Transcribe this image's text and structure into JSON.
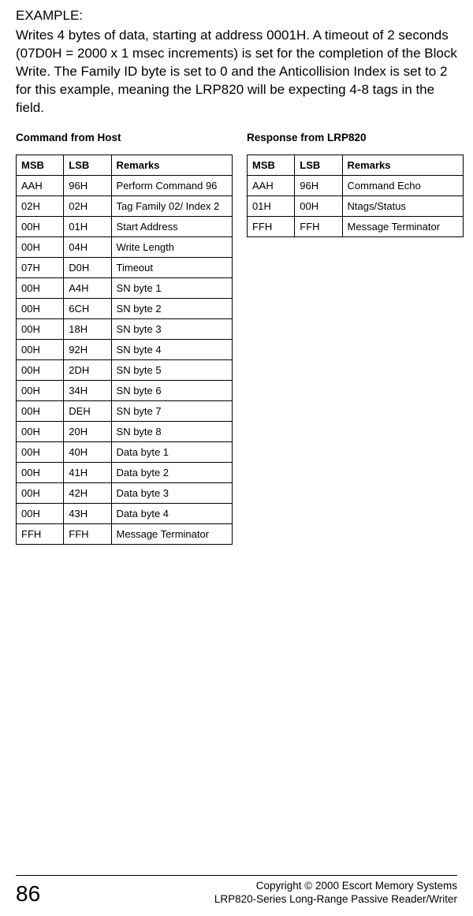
{
  "example_label": "EXAMPLE:",
  "intro": "Writes 4 bytes of data, starting at address 0001H. A timeout of 2 seconds (07D0H = 2000 x 1 msec increments) is set for the completion of the Block Write.  The Family ID byte is set to 0 and the Anticollision Index is set to 2 for this example, meaning the LRP820 will be expecting 4-8 tags in the field.",
  "left_title": "Command from Host",
  "right_title": "Response from LRP820",
  "headers": {
    "msb": "MSB",
    "lsb": "LSB",
    "remarks": "Remarks"
  },
  "left_rows": [
    {
      "msb": "AAH",
      "lsb": "96H",
      "remarks": "Perform Command 96"
    },
    {
      "msb": "02H",
      "lsb": "02H",
      "remarks": "Tag Family 02/ Index 2"
    },
    {
      "msb": "00H",
      "lsb": "01H",
      "remarks": "Start Address"
    },
    {
      "msb": "00H",
      "lsb": "04H",
      "remarks": "Write Length"
    },
    {
      "msb": "07H",
      "lsb": "D0H",
      "remarks": "Timeout"
    },
    {
      "msb": "00H",
      "lsb": "A4H",
      "remarks": "SN byte 1"
    },
    {
      "msb": "00H",
      "lsb": "6CH",
      "remarks": "SN byte 2"
    },
    {
      "msb": "00H",
      "lsb": "18H",
      "remarks": "SN byte 3"
    },
    {
      "msb": "00H",
      "lsb": "92H",
      "remarks": "SN byte 4"
    },
    {
      "msb": "00H",
      "lsb": "2DH",
      "remarks": "SN byte 5"
    },
    {
      "msb": "00H",
      "lsb": "34H",
      "remarks": "SN byte 6"
    },
    {
      "msb": "00H",
      "lsb": "DEH",
      "remarks": "SN byte 7"
    },
    {
      "msb": "00H",
      "lsb": "20H",
      "remarks": "SN byte 8"
    },
    {
      "msb": "00H",
      "lsb": "40H",
      "remarks": "Data byte 1"
    },
    {
      "msb": "00H",
      "lsb": "41H",
      "remarks": "Data byte 2"
    },
    {
      "msb": "00H",
      "lsb": "42H",
      "remarks": "Data byte 3"
    },
    {
      "msb": "00H",
      "lsb": "43H",
      "remarks": "Data byte 4"
    },
    {
      "msb": "FFH",
      "lsb": "FFH",
      "remarks": "Message Terminator"
    }
  ],
  "right_rows": [
    {
      "msb": "AAH",
      "lsb": "96H",
      "remarks": "Command Echo"
    },
    {
      "msb": "01H",
      "lsb": "00H",
      "remarks": "Ntags/Status"
    },
    {
      "msb": "FFH",
      "lsb": "FFH",
      "remarks": "Message Terminator"
    }
  ],
  "page_number": "86",
  "copyright_line1": "Copyright © 2000 Escort Memory Systems",
  "copyright_line2": "LRP820-Series Long-Range Passive Reader/Writer"
}
